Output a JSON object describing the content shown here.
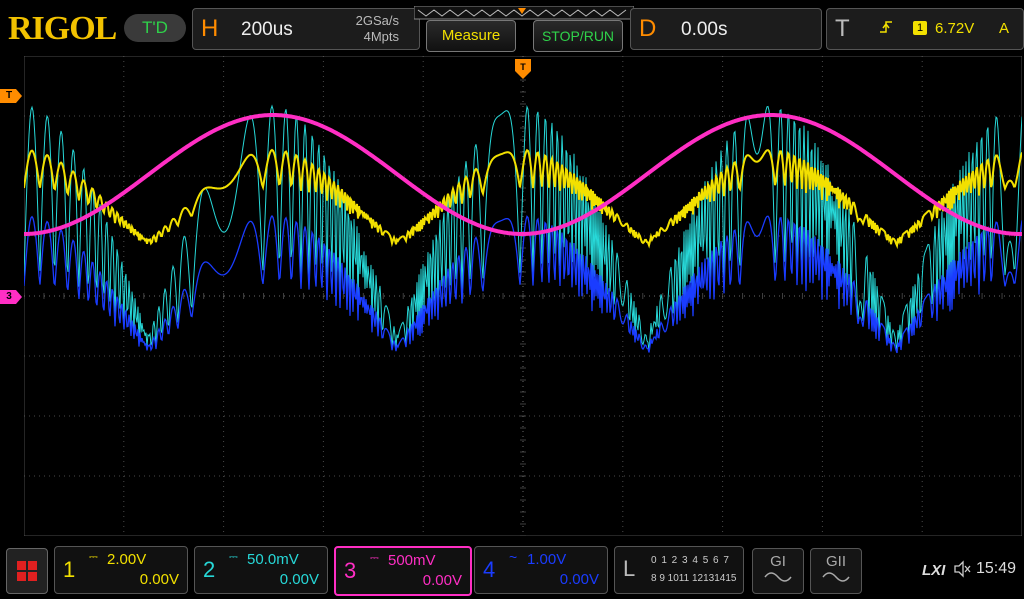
{
  "header": {
    "brand": "RIGOL",
    "run_status": "T'D",
    "horizontal": {
      "letter": "H",
      "timebase": "200us",
      "sample_rate": "2GSa/s",
      "memory_depth": "4Mpts"
    },
    "measure_label": "Measure",
    "stop_run_label": "STOP/RUN",
    "delay": {
      "letter": "D",
      "value": "0.00s"
    },
    "trigger": {
      "letter": "T",
      "source": "1",
      "level": "6.72V",
      "mode": "A",
      "edge_icon": "rising-edge-icon"
    }
  },
  "markers": {
    "trigger_level": "T",
    "ch3_ground": "3"
  },
  "channels": [
    {
      "number": "1",
      "scale": "2.00V",
      "offset": "0.00V",
      "coupling_icon": "dc-coupling-icon",
      "color": "#f2e000"
    },
    {
      "number": "2",
      "scale": "50.0mV",
      "offset": "0.00V",
      "coupling_icon": "dc-coupling-icon",
      "color": "#27d8d8"
    },
    {
      "number": "3",
      "scale": "500mV",
      "offset": "0.00V",
      "coupling_icon": "dc-coupling-icon",
      "color": "#ff2ec4"
    },
    {
      "number": "4",
      "scale": "1.00V",
      "offset": "0.00V",
      "coupling_icon": "ac-coupling-icon",
      "color": "#1a3cff"
    }
  ],
  "logic": {
    "letter": "L",
    "row1": "0 1 2 3  4 5 6 7",
    "row2": "8 9 1011 12131415"
  },
  "gen1": {
    "label": "GI"
  },
  "gen2": {
    "label": "GII"
  },
  "status": {
    "lxi": "LXI",
    "time": "15:49"
  },
  "colors": {
    "accent": "#ff8c00",
    "ch1": "#f2e000",
    "ch2": "#27d8d8",
    "ch3": "#ff2ec4",
    "ch4": "#1a3cff",
    "run_green": "#2fd24a"
  }
}
